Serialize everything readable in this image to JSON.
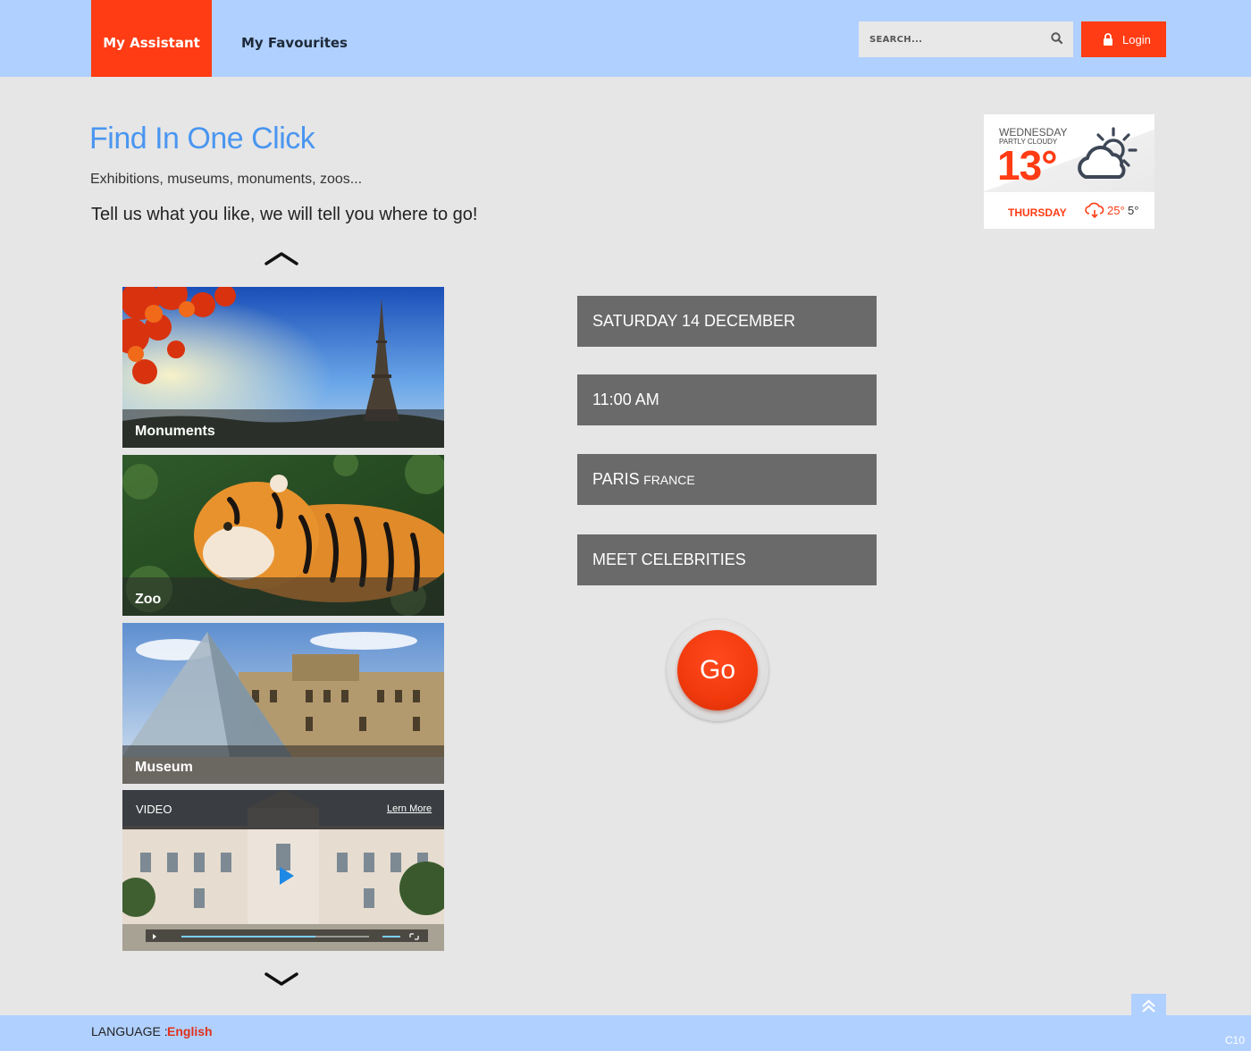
{
  "nav": {
    "items": [
      {
        "label": "My Assistant",
        "active": true
      },
      {
        "label": "My Favourites",
        "active": false
      }
    ]
  },
  "search": {
    "placeholder": "SEARCH..."
  },
  "login": {
    "label": "Login"
  },
  "intro": {
    "title": "Find In One Click",
    "subtitle": "Exhibitions, museums, monuments, zoos...",
    "tagline": "Tell us what you like, we will tell you where to go!"
  },
  "weather": {
    "day": "WEDNESDAY",
    "condition": "PARTLY CLOUDY",
    "temperature": "13°",
    "next_day": "THURSDAY",
    "next_high": "25°",
    "next_low": "5°",
    "icon": "partly-cloudy-icon"
  },
  "categories": [
    {
      "label": "Monuments",
      "image": "eiffel-tower"
    },
    {
      "label": "Zoo",
      "image": "tiger"
    },
    {
      "label": "Museum",
      "image": "louvre-pyramid"
    }
  ],
  "video": {
    "label": "VIDEO",
    "link": "Lern More"
  },
  "fields": {
    "date": "SATURDAY 14 DECEMBER",
    "time": "11:00 AM",
    "city": "PARIS",
    "country": "FRANCE",
    "interest": "MEET CELEBRITIES"
  },
  "go_button": {
    "label": "Go"
  },
  "footer": {
    "language_label": "LANGUAGE :",
    "language_value": "English",
    "page_code": "C10"
  },
  "colors": {
    "accent": "#ff3c14",
    "header_bg": "#b0d0ff",
    "title_blue": "#4a96f0",
    "field_bg": "#6a6a6a"
  }
}
